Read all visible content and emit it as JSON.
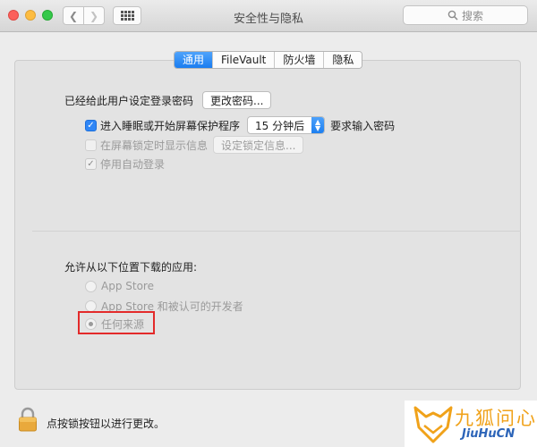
{
  "window": {
    "title": "安全性与隐私",
    "search_placeholder": "搜索"
  },
  "tabs": [
    {
      "label": "通用",
      "active": true
    },
    {
      "label": "FileVault",
      "active": false
    },
    {
      "label": "防火墙",
      "active": false
    },
    {
      "label": "隐私",
      "active": false
    }
  ],
  "general": {
    "password_set_label": "已经给此用户设定登录密码",
    "change_password_button": "更改密码...",
    "require_password": {
      "prefix": "进入睡眠或开始屏幕保护程序",
      "delay_value": "15 分钟后",
      "suffix": "要求输入密码",
      "checked": true
    },
    "show_message": {
      "label": "在屏幕锁定时显示信息",
      "checked": false,
      "enabled": false
    },
    "set_lock_message_button": "设定锁定信息...",
    "disable_auto_login": {
      "label": "停用自动登录",
      "checked": true,
      "enabled": false
    }
  },
  "downloads": {
    "label": "允许从以下位置下载的应用:",
    "options": [
      {
        "label": "App Store",
        "selected": false
      },
      {
        "label": "App Store 和被认可的开发者",
        "selected": false
      },
      {
        "label": "任何来源",
        "selected": true
      }
    ]
  },
  "footer": {
    "lock_text": "点按锁按钮以进行更改。"
  },
  "watermark": {
    "cn": "九狐问心",
    "en": "JiuHuCN"
  },
  "colors": {
    "accent": "#1a7df0",
    "highlight_box": "#e32a2a",
    "watermark_orange": "#f0a21a",
    "watermark_blue": "#2c64b8"
  }
}
